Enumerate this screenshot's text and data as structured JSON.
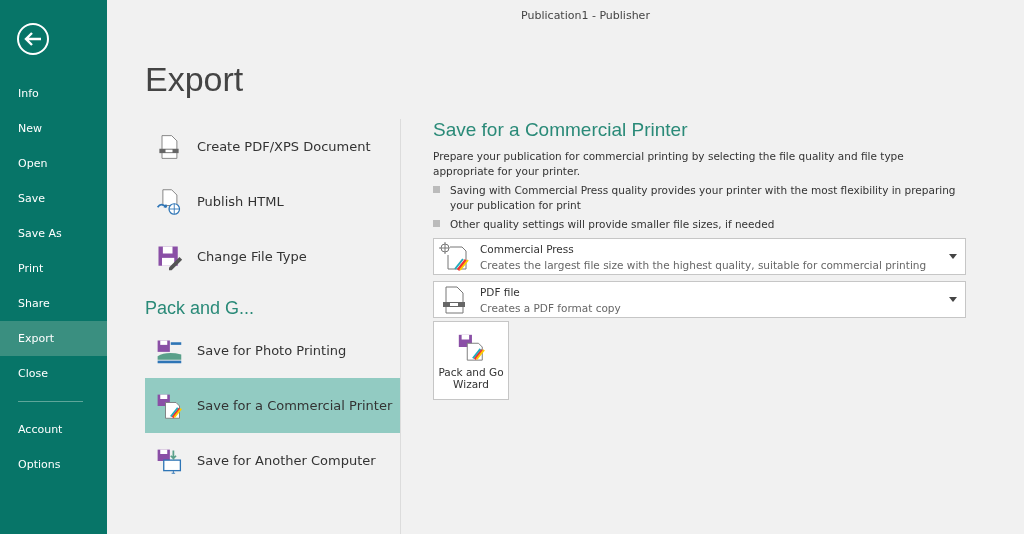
{
  "window": {
    "title": "Publication1 - Publisher"
  },
  "sidebar": {
    "items": [
      {
        "label": "Info",
        "selected": false
      },
      {
        "label": "New",
        "selected": false
      },
      {
        "label": "Open",
        "selected": false
      },
      {
        "label": "Save",
        "selected": false
      },
      {
        "label": "Save As",
        "selected": false
      },
      {
        "label": "Print",
        "selected": false
      },
      {
        "label": "Share",
        "selected": false
      },
      {
        "label": "Export",
        "selected": true
      },
      {
        "label": "Close",
        "selected": false
      }
    ],
    "bottom_items": [
      {
        "label": "Account",
        "selected": false
      },
      {
        "label": "Options",
        "selected": false
      }
    ]
  },
  "page_title": "Export",
  "export_options": [
    {
      "kind": "pdf",
      "label": "Create PDF/XPS Document",
      "selected": false
    },
    {
      "kind": "html",
      "label": "Publish HTML",
      "selected": false
    },
    {
      "kind": "filetype",
      "label": "Change File Type",
      "selected": false
    }
  ],
  "pack_section": {
    "title": "Pack and G...",
    "options": [
      {
        "kind": "photo",
        "label": "Save for Photo Printing",
        "selected": false
      },
      {
        "kind": "commercial",
        "label": "Save for a Commercial Printer",
        "selected": true
      },
      {
        "kind": "computer",
        "label": "Save for Another Computer",
        "selected": false
      }
    ]
  },
  "detail": {
    "title": "Save for a Commercial Printer",
    "description": "Prepare your publication for commercial printing by selecting the file quality and file type appropriate for your printer.",
    "bullets": [
      "Saving with Commercial Press quality provides your printer with the most flexibility in preparing your publication for print",
      "Other quality settings will provide smaller file sizes, if needed"
    ],
    "dropdowns": [
      {
        "kind": "commercial",
        "title": "Commercial Press",
        "subtitle": "Creates the largest file size with the highest quality, suitable for commercial printing"
      },
      {
        "kind": "pdf",
        "title": "PDF file",
        "subtitle": "Creates a PDF format copy"
      }
    ],
    "wizard_button": {
      "label": "Pack and Go Wizard"
    }
  }
}
